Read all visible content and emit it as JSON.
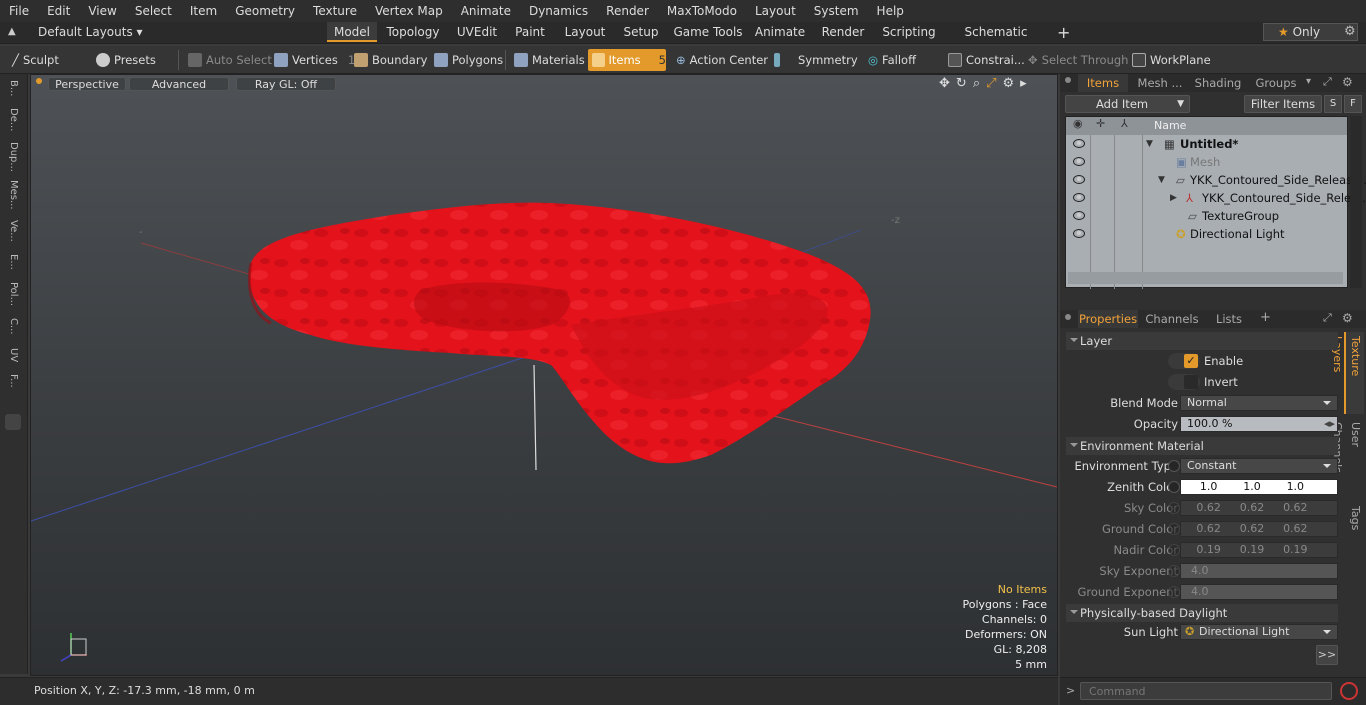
{
  "menu": [
    "File",
    "Edit",
    "View",
    "Select",
    "Item",
    "Geometry",
    "Texture",
    "Vertex Map",
    "Animate",
    "Dynamics",
    "Render",
    "MaxToModo",
    "Layout",
    "System",
    "Help"
  ],
  "layout_dropdown": "Default Layouts",
  "mode_tabs": [
    "Model",
    "Topology",
    "UVEdit",
    "Paint",
    "Layout",
    "Setup",
    "Game Tools",
    "Animate",
    "Render",
    "Scripting",
    "Schematic Fusion"
  ],
  "active_mode": "Model",
  "only_label": "Only",
  "toolbar": {
    "sculpt": "Sculpt",
    "presets": "Presets",
    "auto_select": "Auto Select",
    "vertices": "Vertices",
    "vertices_count": "1",
    "boundary": "Boundary",
    "polygons": "Polygons",
    "materials": "Materials",
    "items": "Items",
    "items_count": "5",
    "action_center": "Action Center",
    "symmetry": "Symmetry",
    "falloff": "Falloff",
    "constraints": "Constrai...",
    "select_through": "Select Through",
    "workplane": "WorkPlane"
  },
  "left_tools": [
    "B...",
    "De...",
    "Dup...",
    "Mes...",
    "Ve...",
    "E...",
    "Pol...",
    "C...",
    "UV",
    "F..."
  ],
  "viewport": {
    "perspective": "Perspective",
    "advanced": "Advanced",
    "raygl": "Ray GL: Off",
    "info": {
      "no_items": "No Items",
      "polygons": "Polygons : Face",
      "channels": "Channels: 0",
      "deformers": "Deformers: ON",
      "gl": "GL: 8,208",
      "unit": "5 mm"
    }
  },
  "status": {
    "position": "Position X, Y, Z:  -17.3 mm, -18 mm, 0 m"
  },
  "items_panel": {
    "tabs": [
      "Items",
      "Mesh ...",
      "Shading",
      "Groups"
    ],
    "add_item": "Add Item",
    "filter_items": "Filter Items",
    "s": "S",
    "f": "F",
    "column_name": "Name",
    "tree": [
      {
        "label": "Untitled*"
      },
      {
        "label": "Mesh"
      },
      {
        "label": "YKK_Contoured_Side_Releas ..."
      },
      {
        "label": "YKK_Contoured_Side_Rele ..."
      },
      {
        "label": "TextureGroup"
      },
      {
        "label": "Directional Light"
      }
    ]
  },
  "props_panel": {
    "tabs": [
      "Properties",
      "Channels",
      "Lists"
    ],
    "plus": "+",
    "side_tabs": [
      "Texture Layers",
      "User Channels",
      "Tags"
    ],
    "layer": {
      "header": "Layer",
      "enable": "Enable",
      "invert": "Invert",
      "blend_mode_label": "Blend Mode",
      "blend_mode": "Normal",
      "opacity_label": "Opacity",
      "opacity": "100.0 %"
    },
    "env": {
      "header": "Environment Material",
      "type_label": "Environment Type",
      "type": "Constant",
      "zenith_label": "Zenith Color",
      "zenith": [
        "1.0",
        "1.0",
        "1.0"
      ],
      "sky_label": "Sky Color",
      "sky": [
        "0.62",
        "0.62",
        "0.62"
      ],
      "ground_label": "Ground Color",
      "ground": [
        "0.62",
        "0.62",
        "0.62"
      ],
      "nadir_label": "Nadir Color",
      "nadir": [
        "0.19",
        "0.19",
        "0.19"
      ],
      "sky_exp_label": "Sky Exponent",
      "sky_exp": "4.0",
      "ground_exp_label": "Ground Exponent",
      "ground_exp": "4.0"
    },
    "daylight": {
      "header": "Physically-based Daylight",
      "sun_label": "Sun Light",
      "sun": "Directional Light"
    },
    "more": ">>"
  },
  "command_placeholder": "Command",
  "colors": {
    "accent": "#e39a2b",
    "model_red": "#e0141c"
  }
}
